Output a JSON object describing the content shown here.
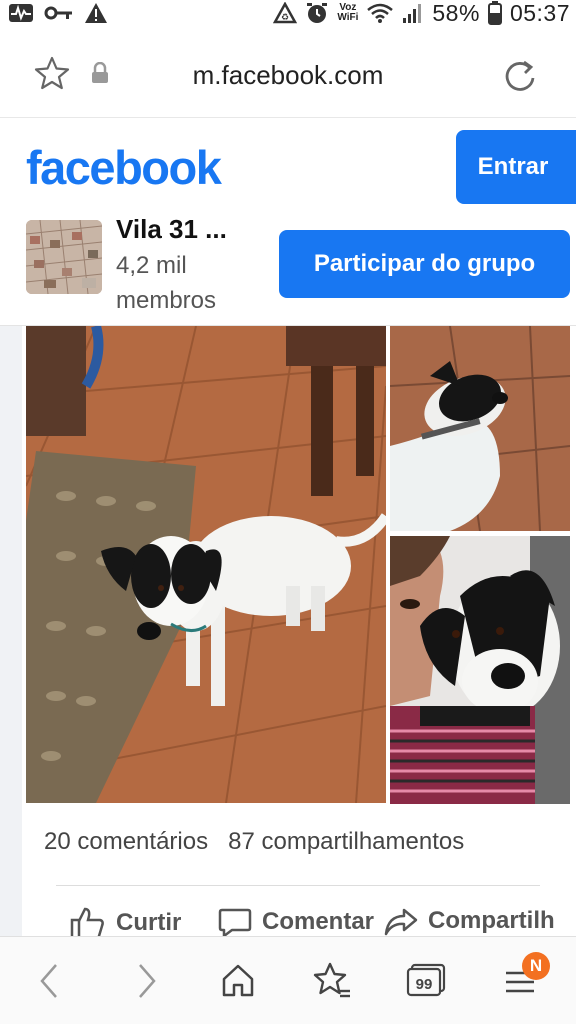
{
  "status_bar": {
    "network_label": "Voz\nWiFi",
    "voz_top": "Voz",
    "voz_bottom": "WiFi",
    "battery": "58%",
    "time": "05:37"
  },
  "browser": {
    "url": "m.facebook.com"
  },
  "header": {
    "logo": "facebook",
    "login_label": "Entrar",
    "brand_color": "#1877f2"
  },
  "group": {
    "name": "Vila 31 ...",
    "members": "4,2 mil membros",
    "join_label": "Participar do grupo"
  },
  "post": {
    "comments": "20 comentários",
    "shares": "87 compartilhamentos",
    "like_label": "Curtir",
    "comment_label": "Comentar",
    "share_label": "Compartilh"
  },
  "bottom_nav": {
    "tabs_count": "99",
    "notification_badge": "N"
  }
}
